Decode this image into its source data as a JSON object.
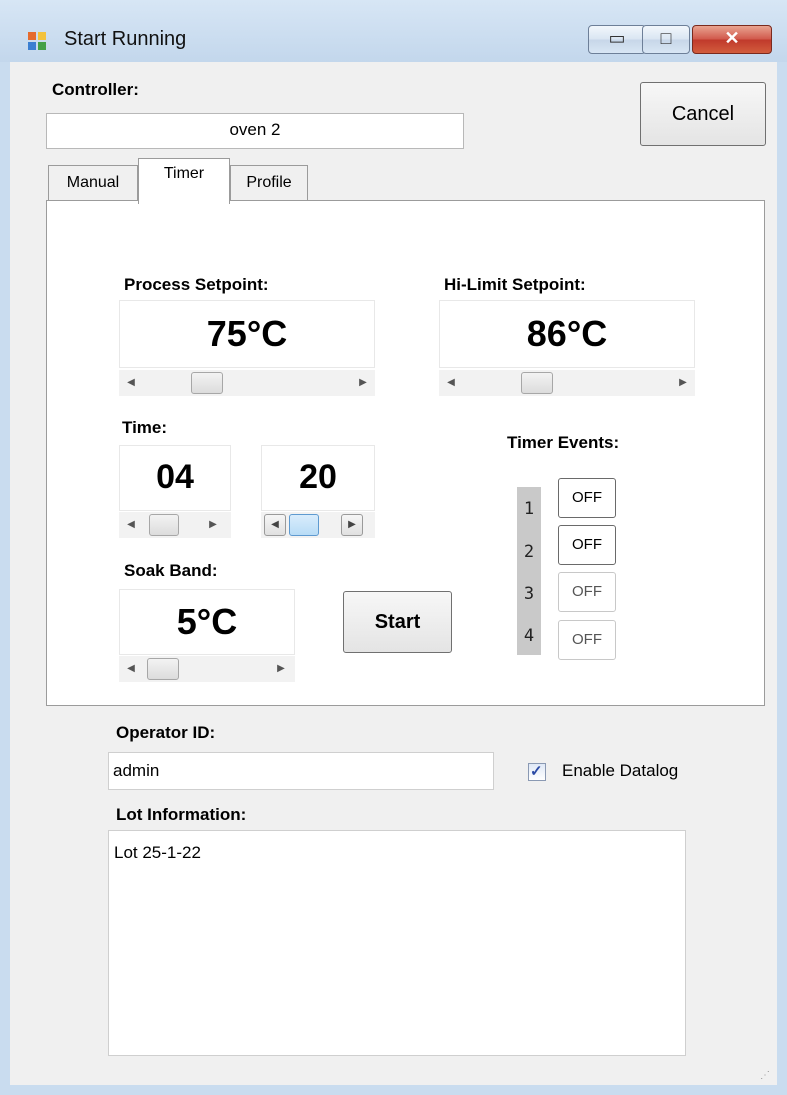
{
  "window": {
    "title": "Start Running",
    "minimize_glyph": "▭",
    "maximize_glyph": "□",
    "close_glyph": "✕"
  },
  "controller": {
    "label": "Controller:",
    "value": "oven 2"
  },
  "cancel_label": "Cancel",
  "tabs": [
    {
      "label": "Manual",
      "selected": false
    },
    {
      "label": "Timer",
      "selected": true
    },
    {
      "label": "Profile",
      "selected": false
    }
  ],
  "timer_panel": {
    "process_setpoint": {
      "label": "Process Setpoint:",
      "value": "75°C"
    },
    "hi_limit_setpoint": {
      "label": "Hi-Limit Setpoint:",
      "value": "86°C"
    },
    "time": {
      "label": "Time:",
      "hours": "04",
      "minutes": "20"
    },
    "soak_band": {
      "label": "Soak Band:",
      "value": "5°C"
    },
    "start_label": "Start",
    "timer_events": {
      "label": "Timer Events:",
      "events": [
        {
          "number": "1",
          "state": "OFF",
          "enabled": true
        },
        {
          "number": "2",
          "state": "OFF",
          "enabled": true
        },
        {
          "number": "3",
          "state": "OFF",
          "enabled": false
        },
        {
          "number": "4",
          "state": "OFF",
          "enabled": false
        }
      ]
    },
    "scroll_left_glyph": "◀",
    "scroll_right_glyph": "▶"
  },
  "operator": {
    "label": "Operator ID:",
    "value": "admin"
  },
  "datalog": {
    "label": "Enable Datalog",
    "checked": true,
    "check_glyph": "✓"
  },
  "lot": {
    "label": "Lot Information:",
    "value": "Lot 25-1-22"
  },
  "colors": {
    "window_frame": "#c9dcef",
    "client_bg": "#f0f0f0",
    "close_button": "#c0392b"
  },
  "resize_grip_glyph": "⋰"
}
